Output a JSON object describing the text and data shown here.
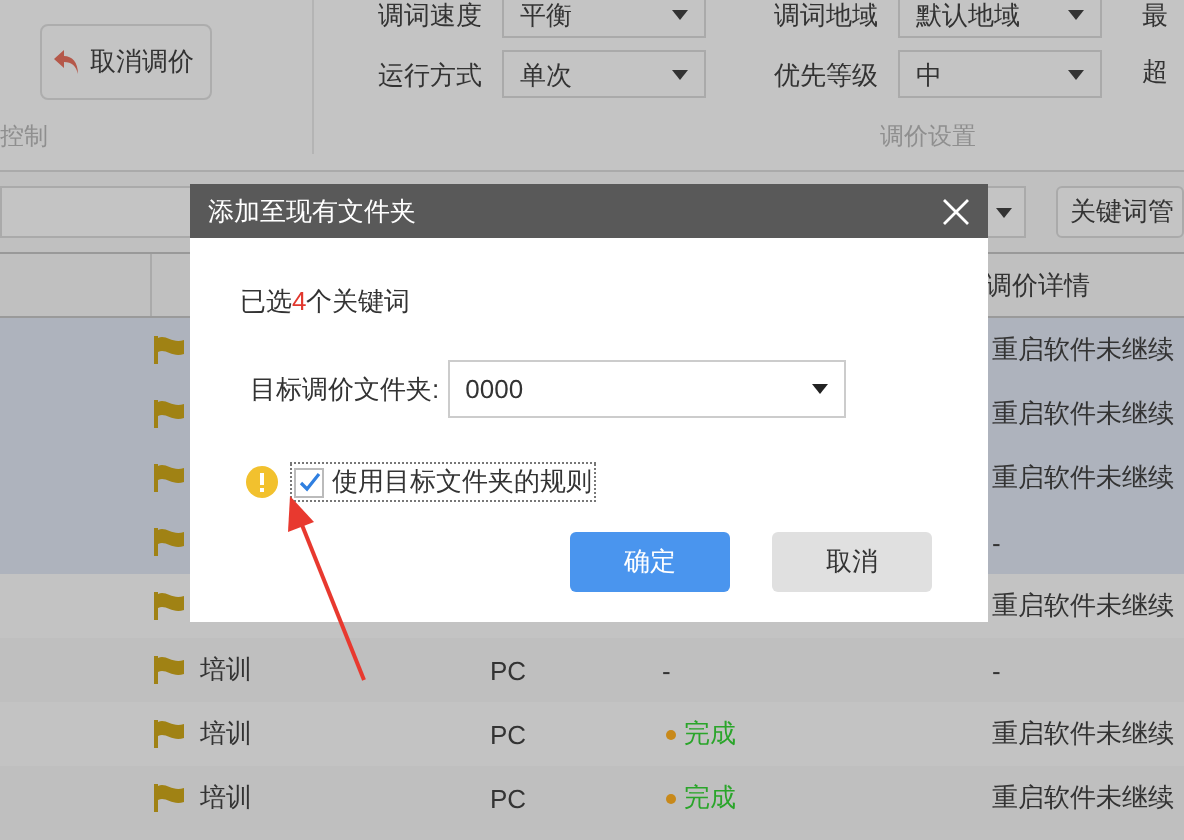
{
  "toolbar": {
    "cancel_button": "取消调价",
    "group_label_left": "控制",
    "settings": [
      {
        "label": "调词速度",
        "value": "平衡"
      },
      {
        "label": "调词地域",
        "value": "默认地域"
      },
      {
        "label": "运行方式",
        "value": "单次"
      },
      {
        "label": "优先等级",
        "value": "中"
      }
    ],
    "cut_labels": [
      "最",
      "超"
    ],
    "group_label_right": "调价设置"
  },
  "filter": {
    "button": "关键词管"
  },
  "table": {
    "column_header": "调价详情",
    "rows": [
      {
        "selected": true,
        "detail": "重启软件未继续"
      },
      {
        "selected": true,
        "detail": "重启软件未继续"
      },
      {
        "selected": true,
        "detail": "重启软件未继续"
      },
      {
        "selected": true,
        "detail": "-"
      },
      {
        "selected": false,
        "detail": "重启软件未继续"
      },
      {
        "selected": false,
        "name": "培训",
        "device": "PC",
        "status": {
          "kind": "none",
          "text": "-"
        },
        "detail": "-"
      },
      {
        "selected": false,
        "name": "培训",
        "device": "PC",
        "status": {
          "kind": "done",
          "text": "完成"
        },
        "detail": "重启软件未继续"
      },
      {
        "selected": false,
        "name": "培训",
        "device": "PC",
        "status": {
          "kind": "done",
          "text": "完成"
        },
        "detail": "重启软件未继续"
      }
    ]
  },
  "dialog": {
    "title": "添加至现有文件夹",
    "selection": {
      "prefix": "已选",
      "count": "4",
      "suffix": "个关键词"
    },
    "folder_label": "目标调价文件夹:",
    "folder_value": "0000",
    "rule_checkbox": {
      "label": "使用目标文件夹的规则",
      "checked": true
    },
    "buttons": [
      {
        "label": "确定",
        "kind": "primary"
      },
      {
        "label": "取消",
        "kind": "secondary"
      }
    ]
  }
}
